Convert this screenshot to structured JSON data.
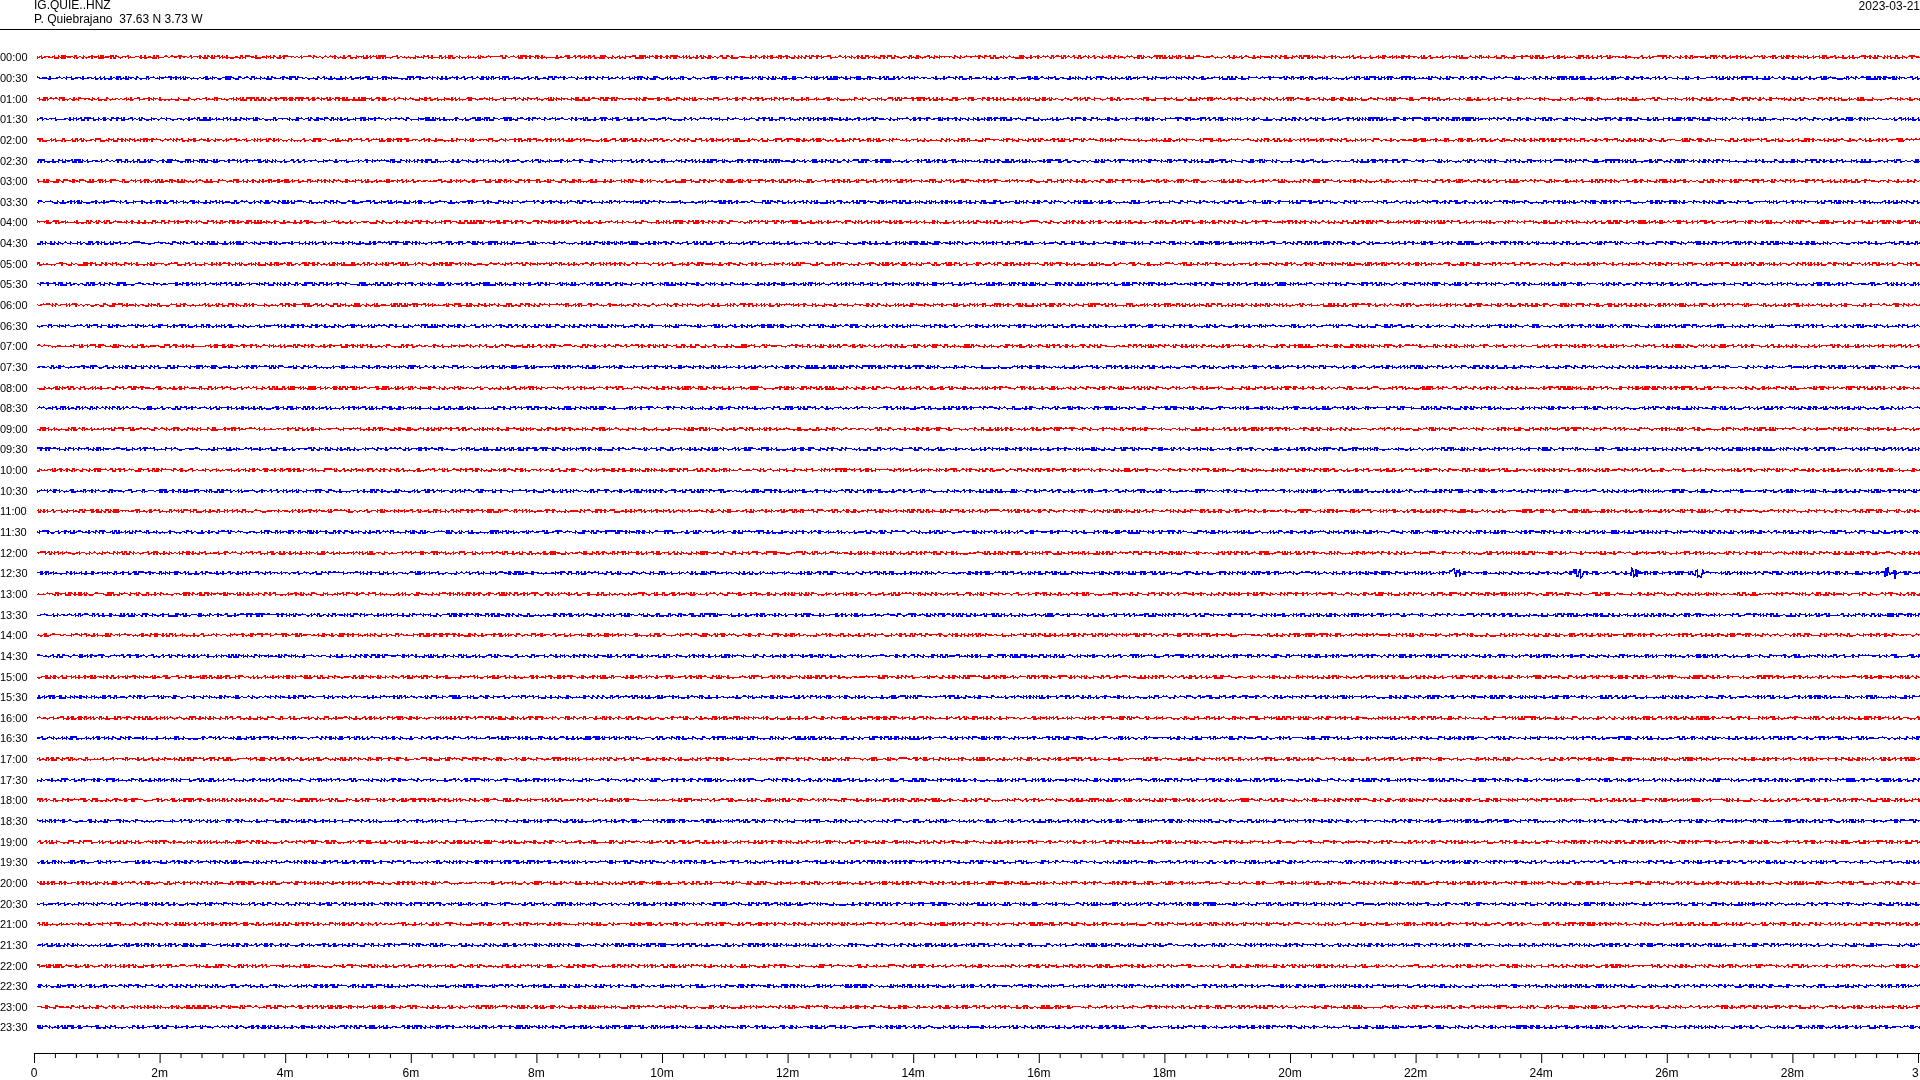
{
  "header": {
    "channel": "IG.QUIE..HNZ",
    "station": "P. Quiebrajano  37.63 N 3.73 W",
    "date": "2023-03-21"
  },
  "rows": [
    {
      "time": "00:00",
      "color": "#ff0000",
      "kind": "quiet"
    },
    {
      "time": "00:30",
      "color": "#0000ff",
      "kind": "quiet"
    },
    {
      "time": "01:00",
      "color": "#ff0000",
      "kind": "quiet"
    },
    {
      "time": "01:30",
      "color": "#0000ff",
      "kind": "quiet"
    },
    {
      "time": "02:00",
      "color": "#ff0000",
      "kind": "quiet"
    },
    {
      "time": "02:30",
      "color": "#0000ff",
      "kind": "quiet"
    },
    {
      "time": "03:00",
      "color": "#ff0000",
      "kind": "quiet"
    },
    {
      "time": "03:30",
      "color": "#0000ff",
      "kind": "quiet"
    },
    {
      "time": "04:00",
      "color": "#ff0000",
      "kind": "quiet"
    },
    {
      "time": "04:30",
      "color": "#0000ff",
      "kind": "quiet"
    },
    {
      "time": "05:00",
      "color": "#ff0000",
      "kind": "quiet"
    },
    {
      "time": "05:30",
      "color": "#0000ff",
      "kind": "quiet"
    },
    {
      "time": "06:00",
      "color": "#ff0000",
      "kind": "quiet"
    },
    {
      "time": "06:30",
      "color": "#0000ff",
      "kind": "quiet"
    },
    {
      "time": "07:00",
      "color": "#ff0000",
      "kind": "quiet"
    },
    {
      "time": "07:30",
      "color": "#0000ff",
      "kind": "quiet"
    },
    {
      "time": "08:00",
      "color": "#ff0000",
      "kind": "quiet"
    },
    {
      "time": "08:30",
      "color": "#0000ff",
      "kind": "quiet"
    },
    {
      "time": "09:00",
      "color": "#ff0000",
      "kind": "quiet"
    },
    {
      "time": "09:30",
      "color": "#0000ff",
      "kind": "quiet"
    },
    {
      "time": "10:00",
      "color": "#ff0000",
      "kind": "quiet"
    },
    {
      "time": "10:30",
      "color": "#0000ff",
      "kind": "quiet"
    },
    {
      "time": "11:00",
      "color": "#ff0000",
      "kind": "quiet"
    },
    {
      "time": "11:30",
      "color": "#0000ff",
      "kind": "quiet"
    },
    {
      "time": "12:00",
      "color": "#ff0000",
      "kind": "quiet"
    },
    {
      "time": "12:30",
      "color": "#0000ff",
      "kind": "events"
    },
    {
      "time": "13:00",
      "color": "#ff0000",
      "kind": "quiet"
    },
    {
      "time": "13:30",
      "color": "#0000ff",
      "kind": "quiet"
    },
    {
      "time": "14:00",
      "color": "#ff0000",
      "kind": "quiet"
    },
    {
      "time": "14:30",
      "color": "#0000ff",
      "kind": "quiet"
    },
    {
      "time": "15:00",
      "color": "#ff0000",
      "kind": "quiet"
    },
    {
      "time": "15:30",
      "color": "#0000ff",
      "kind": "quiet"
    },
    {
      "time": "16:00",
      "color": "#ff0000",
      "kind": "quiet"
    },
    {
      "time": "16:30",
      "color": "#0000ff",
      "kind": "quiet"
    },
    {
      "time": "17:00",
      "color": "#ff0000",
      "kind": "quiet"
    },
    {
      "time": "17:30",
      "color": "#0000ff",
      "kind": "quiet"
    },
    {
      "time": "18:00",
      "color": "#ff0000",
      "kind": "quiet"
    },
    {
      "time": "18:30",
      "color": "#0000ff",
      "kind": "quiet"
    },
    {
      "time": "19:00",
      "color": "#ff0000",
      "kind": "quiet"
    },
    {
      "time": "19:30",
      "color": "#0000ff",
      "kind": "quiet"
    },
    {
      "time": "20:00",
      "color": "#ff0000",
      "kind": "quiet"
    },
    {
      "time": "20:30",
      "color": "#0000ff",
      "kind": "quiet"
    },
    {
      "time": "21:00",
      "color": "#ff0000",
      "kind": "quiet"
    },
    {
      "time": "21:30",
      "color": "#0000ff",
      "kind": "quiet"
    },
    {
      "time": "22:00",
      "color": "#ff0000",
      "kind": "quiet"
    },
    {
      "time": "22:30",
      "color": "#0000ff",
      "kind": "quiet"
    },
    {
      "time": "23:00",
      "color": "#ff0000",
      "kind": "quiet"
    },
    {
      "time": "23:30",
      "color": "#0000ff",
      "kind": "quiet"
    }
  ],
  "axis_labels": [
    "0",
    "2m",
    "4m",
    "6m",
    "8m",
    "10m",
    "12m",
    "14m",
    "16m",
    "18m",
    "20m",
    "22m",
    "24m",
    "26m",
    "28m",
    "3"
  ]
}
